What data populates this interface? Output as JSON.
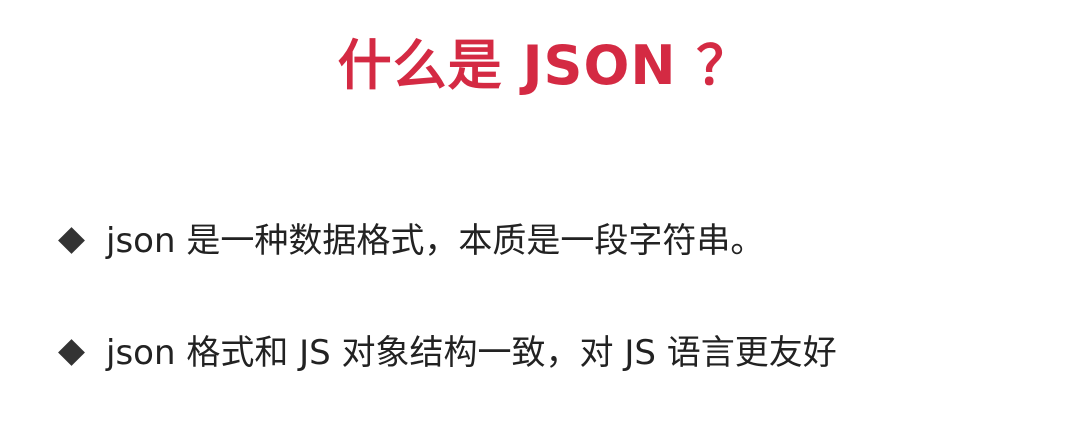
{
  "slide": {
    "title": "什么是 JSON ？",
    "bullets": [
      {
        "icon": "diamond-bullet-icon",
        "text": "json 是一种数据格式，本质是一段字符串。"
      },
      {
        "icon": "diamond-bullet-icon",
        "text": "json 格式和 JS 对象结构一致，对 JS 语言更友好"
      }
    ],
    "colors": {
      "title": "#d42a43",
      "text": "#222222",
      "bullet": "#333333",
      "background": "#ffffff"
    }
  }
}
